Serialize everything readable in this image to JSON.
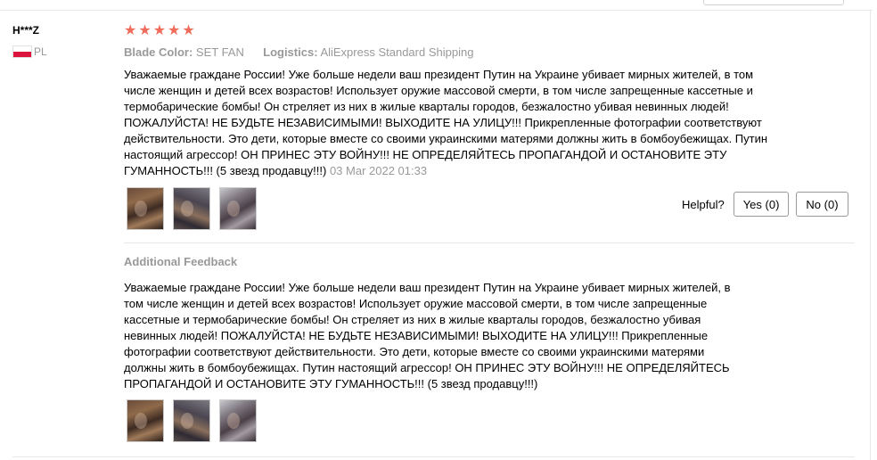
{
  "review": {
    "user_name": "H***Z",
    "country_code": "PL",
    "rating": 5,
    "meta": {
      "blade_color_label": "Blade Color:",
      "blade_color_value": "SET FAN",
      "logistics_label": "Logistics:",
      "logistics_value": "AliExpress Standard Shipping"
    },
    "text": "Уважаемые граждане России! Уже больше недели ваш президент Путин на Украине убивает мирных жителей, в том числе женщин и детей всех возрастов! Использует оружие массовой смерти, в том числе запрещенные кассетные и термобарические бомбы! Он стреляет из них в жилые кварталы городов, безжалостно убивая невинных людей! ПОЖАЛУЙСТА! НЕ БУДЬТЕ НЕЗАВИСИМЫМИ! ВЫХОДИТЕ НА УЛИЦУ!!! Прикрепленные фотографии соответствуют действительности. Это дети, которые вместе со своими украинскими матерями должны жить в бомбоубежищах. Путин настоящий агрессор! ОН ПРИНЕС ЭТУ ВОЙНУ!!! НЕ ОПРЕДЕЛЯЙТЕСЬ ПРОПАГАНДОЙ И ОСТАНОВИТЕ ЭТУ ГУМАННОСТЬ!!! (5 звезд продавцу!!!)",
    "date": "03 Mar 2022 01:33",
    "helpful_label": "Helpful?",
    "yes_label": "Yes (0)",
    "no_label": "No (0)"
  },
  "additional": {
    "title": "Additional Feedback",
    "text": "Уважаемые граждане России! Уже больше недели ваш президент Путин на Украине убивает мирных жителей, в том числе женщин и детей всех возрастов! Использует оружие массовой смерти, в том числе запрещенные кассетные и термобарические бомбы! Он стреляет из них в жилые кварталы городов, безжалостно убивая невинных людей! ПОЖАЛУЙСТА! НЕ БУДЬТЕ НЕЗАВИСИМЫМИ! ВЫХОДИТЕ НА УЛИЦУ!!! Прикрепленные фотографии соответствуют действительности. Это дети, которые вместе со своими украинскими матерями должны жить в бомбоубежищах. Путин настоящий агрессор! ОН ПРИНЕС ЭТУ ВОЙНУ!!! НЕ ОПРЕДЕЛЯЙТЕСЬ ПРОПАГАНДОЙ И ОСТАНОВИТЕ ЭТУ ГУМАННОСТЬ!!! (5 звезд продавцу!!!)"
  },
  "colors": {
    "star": "#f06c5a",
    "muted": "#999999",
    "flag_red": "#dc143c"
  }
}
